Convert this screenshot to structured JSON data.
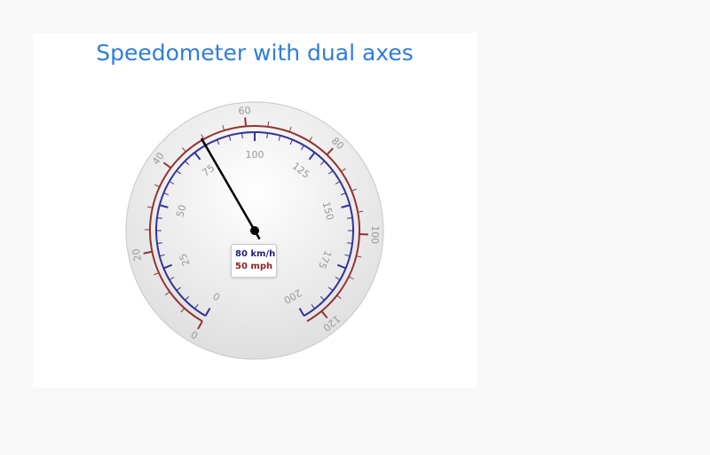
{
  "chart_data": {
    "type": "gauge",
    "title": "Speedometer with dual axes",
    "start_angle_deg": -150,
    "end_angle_deg": 150,
    "colors": {
      "title": "#2f7ed8",
      "inner_axis": "#333399",
      "outer_axis": "#933333",
      "needle": "#000000",
      "tick_labels": "#999999"
    },
    "axes": [
      {
        "name": "km/h",
        "position": "inner",
        "min": 0,
        "max": 200,
        "tick_interval": 25,
        "minor_tick_interval": 5,
        "tick_labels": [
          "0",
          "25",
          "50",
          "75",
          "100",
          "125",
          "150",
          "175",
          "200"
        ]
      },
      {
        "name": "mph",
        "position": "outer",
        "min": 0,
        "max": 124,
        "tick_interval": 20,
        "minor_tick_interval": 5,
        "tick_labels": [
          "0",
          "20",
          "40",
          "60",
          "80",
          "100",
          "120"
        ]
      }
    ],
    "value": 80,
    "tooltip": {
      "kmh": "80 km/h",
      "mph": "50 mph"
    }
  }
}
